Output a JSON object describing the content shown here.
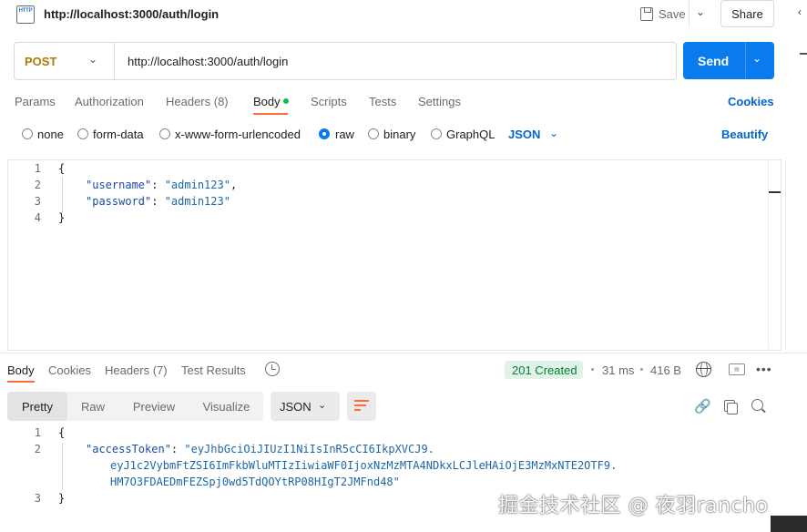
{
  "request": {
    "title": "http://localhost:3000/auth/login",
    "save_label": "Save",
    "share_label": "Share",
    "method": "POST",
    "url": "http://localhost:3000/auth/login",
    "send_label": "Send",
    "tabs": [
      "Params",
      "Authorization",
      "Headers (8)",
      "Body",
      "Scripts",
      "Tests",
      "Settings"
    ],
    "active_tab": "Body",
    "cookies_label": "Cookies",
    "body_types": [
      "none",
      "form-data",
      "x-www-form-urlencoded",
      "raw",
      "binary",
      "GraphQL"
    ],
    "selected_body_type": "raw",
    "format": "JSON",
    "beautify_label": "Beautify",
    "body_lines": [
      "1",
      "2",
      "3",
      "4"
    ],
    "body": {
      "open": "{",
      "key1": "\"username\"",
      "val1": "\"admin123\"",
      "key2": "\"password\"",
      "val2": "\"admin123\"",
      "close": "}"
    }
  },
  "response": {
    "tabs": [
      "Body",
      "Cookies",
      "Headers (7)",
      "Test Results"
    ],
    "active_tab": "Body",
    "status": "201 Created",
    "time": "31 ms",
    "size": "416 B",
    "views": [
      "Pretty",
      "Raw",
      "Preview",
      "Visualize"
    ],
    "active_view": "Pretty",
    "format": "JSON",
    "lines": [
      "1",
      "2",
      "3"
    ],
    "body": {
      "open": "{",
      "key": "\"accessToken\"",
      "token_line1": "\"eyJhbGciOiJIUzI1NiIsInR5cCI6IkpXVCJ9.",
      "token_line2": "eyJ1c2VybmFtZSI6ImFkbWluMTIzIiwiaWF0IjoxNzMzMTA4NDkxLCJleHAiOjE3MzMxNTE2OTF9.",
      "token_line3": "HM7O3FDAEDmFEZSpj0wd5TdQOYtRP08HIgT2JMFnd48\"",
      "close": "}"
    }
  },
  "watermark": "掘金技术社区 @ 夜羽rancho",
  "colors": {
    "accent": "#097bed",
    "tab_underline": "#ff6c37",
    "method": "#ad7a03",
    "status_bg": "#e1f3e6",
    "status_text": "#007f31"
  }
}
